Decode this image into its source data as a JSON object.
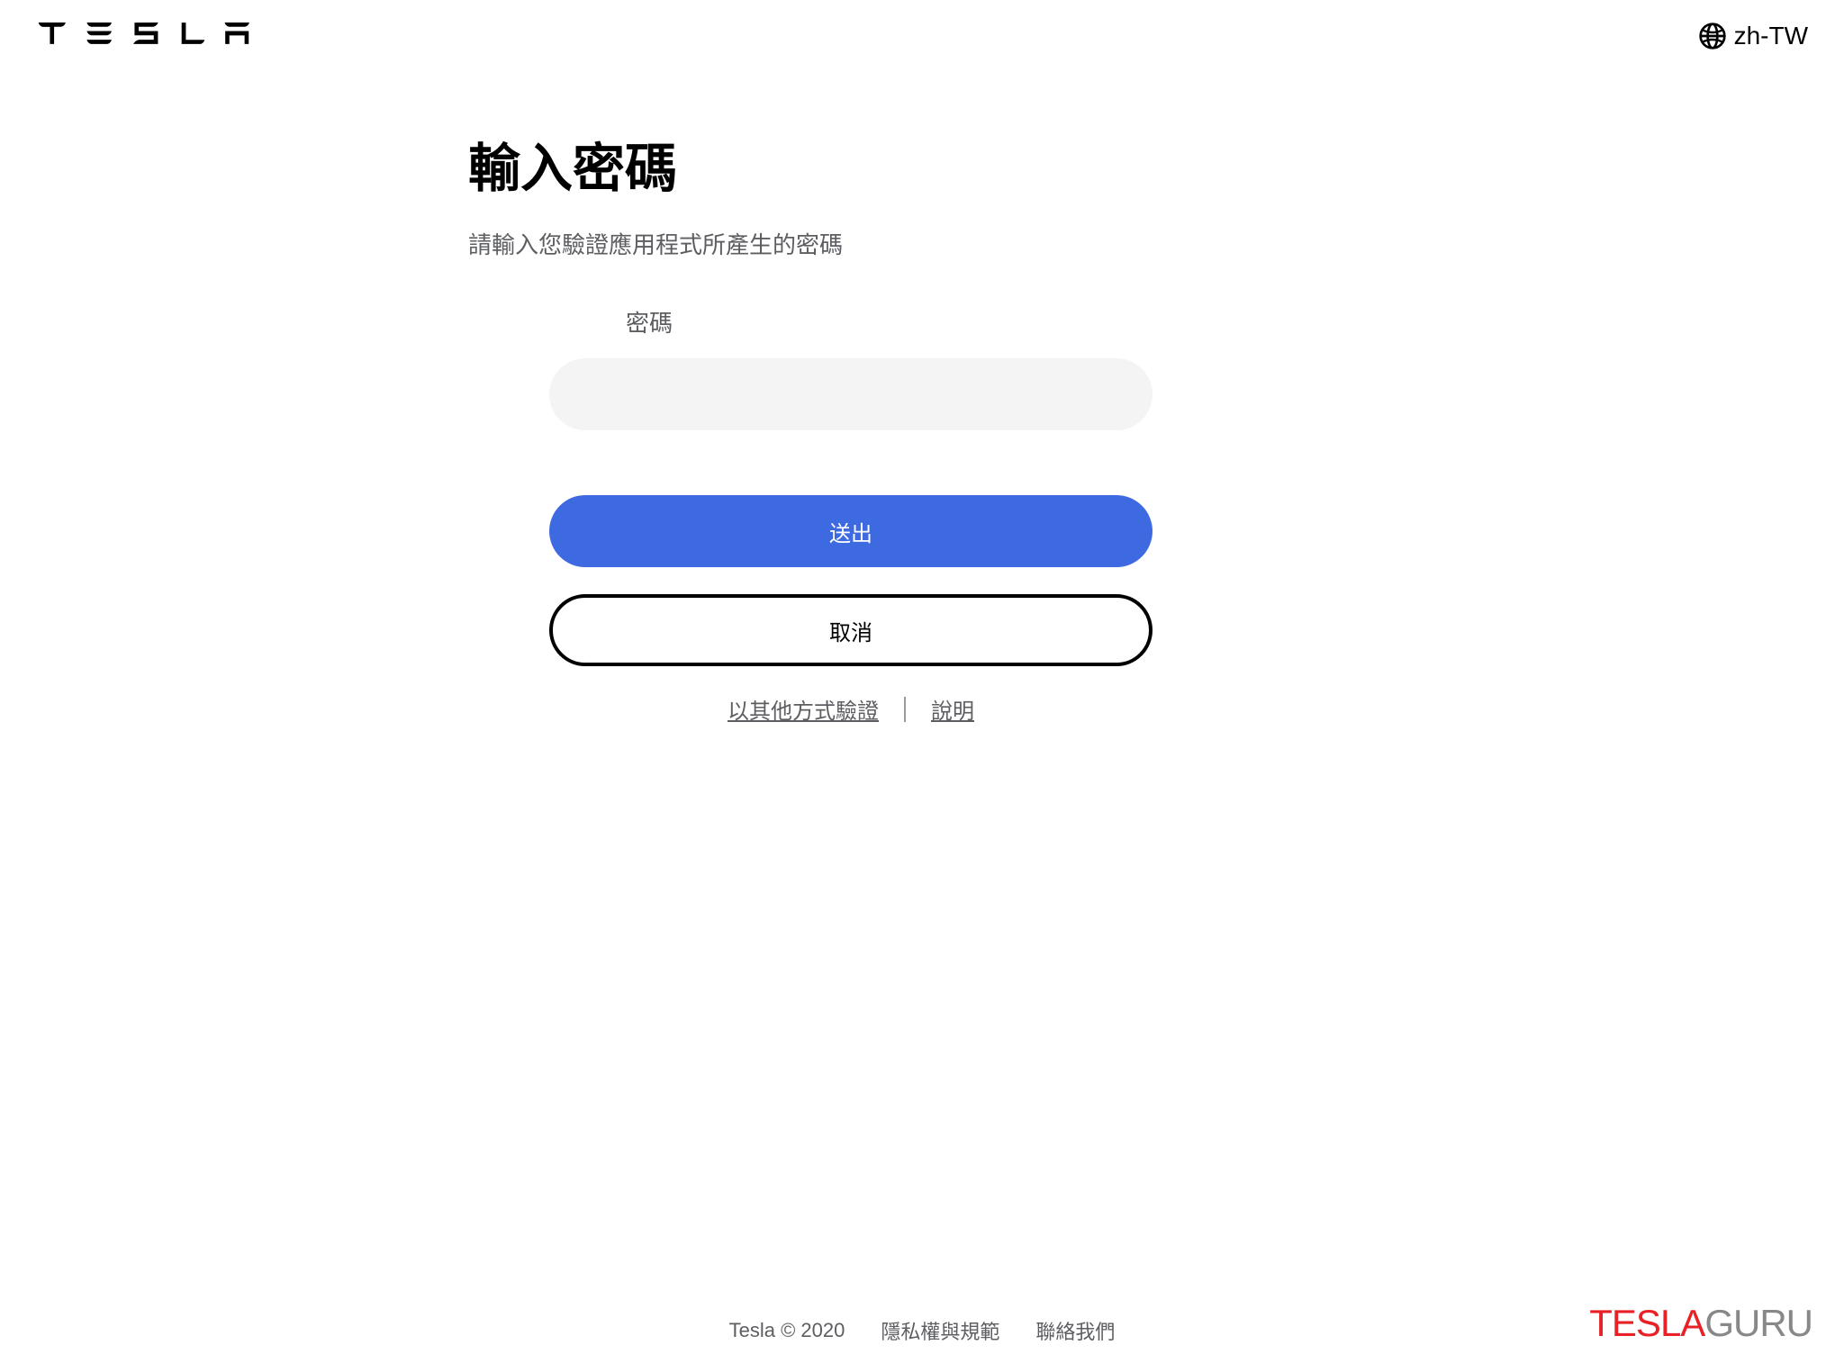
{
  "header": {
    "logo": "T E S L A",
    "language": "zh-TW"
  },
  "form": {
    "title": "輸入密碼",
    "subtitle": "請輸入您驗證應用程式所產生的密碼",
    "password_label": "密碼",
    "password_value": "",
    "submit_label": "送出",
    "cancel_label": "取消"
  },
  "links": {
    "alternate_verify": "以其他方式驗證",
    "help": "說明"
  },
  "footer": {
    "copyright": "Tesla © 2020",
    "privacy": "隱私權與規範",
    "contact": "聯絡我們"
  },
  "watermark": {
    "part1": "TESLA",
    "part2": "GURU"
  }
}
